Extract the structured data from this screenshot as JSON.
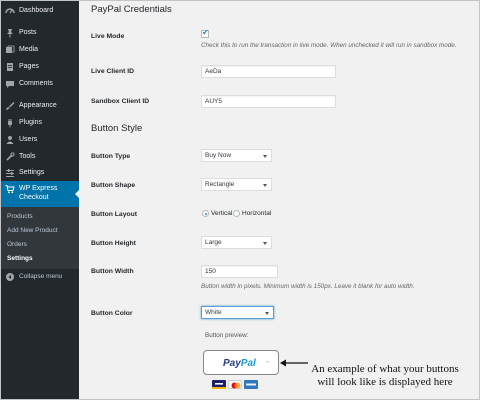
{
  "sidebar": {
    "items": [
      {
        "label": "Dashboard",
        "icon": "dashboard-icon"
      },
      {
        "label": "Posts",
        "icon": "pin-icon"
      },
      {
        "label": "Media",
        "icon": "media-icon"
      },
      {
        "label": "Pages",
        "icon": "pages-icon"
      },
      {
        "label": "Comments",
        "icon": "comments-icon"
      },
      {
        "label": "Appearance",
        "icon": "paintbrush-icon"
      },
      {
        "label": "Plugins",
        "icon": "plugins-icon"
      },
      {
        "label": "Users",
        "icon": "users-icon"
      },
      {
        "label": "Tools",
        "icon": "tools-icon"
      },
      {
        "label": "Settings",
        "icon": "settings-icon"
      }
    ],
    "active": {
      "label": "WP Express Checkout",
      "icon": "cart-icon"
    },
    "submenu": [
      "Products",
      "Add New Product",
      "Orders",
      "Settings"
    ],
    "collapse_label": "Collapse menu"
  },
  "credentials": {
    "title": "PayPal Credentials",
    "live_mode_label": "Live Mode",
    "live_mode_checked": true,
    "live_mode_desc": "Check this to run the transaction in live mode. When unchecked it will run in sandbox mode.",
    "live_client_id_label": "Live Client ID",
    "live_client_id_value": "AeDa",
    "sandbox_client_id_label": "Sandbox Client ID",
    "sandbox_client_id_value": "AUY5"
  },
  "button_style": {
    "title": "Button Style",
    "type_label": "Button Type",
    "type_value": "Buy Now",
    "shape_label": "Button Shape",
    "shape_value": "Rectangle",
    "layout_label": "Button Layout",
    "layout_options": [
      "Vertical",
      "Horizontal"
    ],
    "layout_selected": "Vertical",
    "height_label": "Button Height",
    "height_value": "Large",
    "width_label": "Button Width",
    "width_value": "150",
    "width_desc": "Button width in pixels. Minimum width is 150px. Leave it blank for auto width.",
    "color_label": "Button Color",
    "color_value": "White",
    "preview_label": "Button preview:",
    "paypal_word_1": "Pay",
    "paypal_word_2": "Pal",
    "paypal_dash": "-"
  },
  "callout": {
    "line1": "An example of what your buttons",
    "line2": "will look like is displayed here"
  },
  "colors": {
    "sidebar_bg": "#23282d",
    "active_bg": "#0073aa",
    "paypal_dark": "#253b80",
    "paypal_light": "#179bd7"
  }
}
